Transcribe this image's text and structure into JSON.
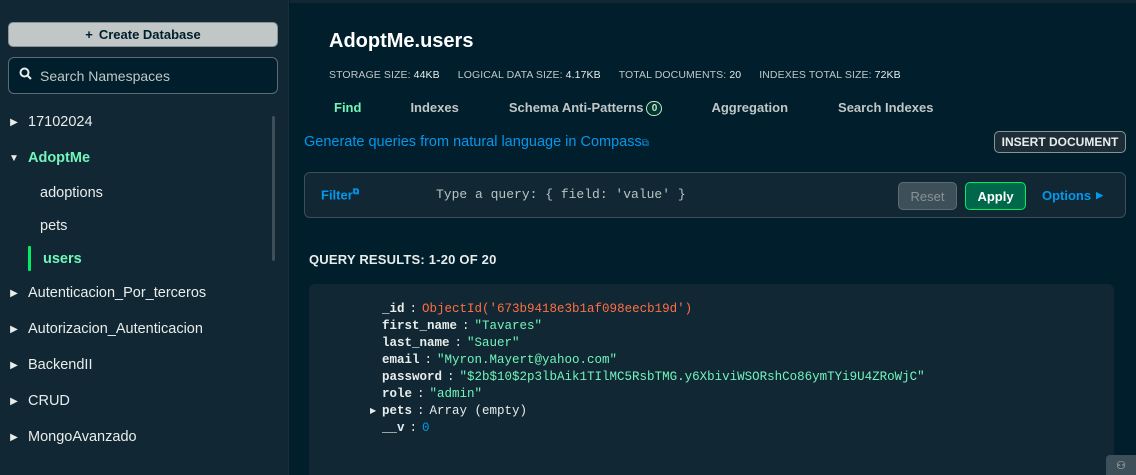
{
  "sidebar": {
    "create_label": "Create Database",
    "search_placeholder": "Search Namespaces",
    "databases": [
      {
        "name": "17102024"
      },
      {
        "name": "AdoptMe",
        "collections": [
          "adoptions",
          "pets",
          "users"
        ],
        "active_collection": "users"
      },
      {
        "name": "Autenticacion_Por_terceros"
      },
      {
        "name": "Autorizacion_Autenticacion"
      },
      {
        "name": "BackendII"
      },
      {
        "name": "CRUD"
      },
      {
        "name": "MongoAvanzado"
      }
    ]
  },
  "header": {
    "title": "AdoptMe.users",
    "stats": [
      {
        "label": "STORAGE SIZE:",
        "value": "44KB"
      },
      {
        "label": "LOGICAL DATA SIZE:",
        "value": "4.17KB"
      },
      {
        "label": "TOTAL DOCUMENTS:",
        "value": "20"
      },
      {
        "label": "INDEXES TOTAL SIZE:",
        "value": "72KB"
      }
    ],
    "tabs": [
      {
        "label": "Find",
        "active": true
      },
      {
        "label": "Indexes"
      },
      {
        "label": "Schema Anti-Patterns",
        "badge": "0"
      },
      {
        "label": "Aggregation"
      },
      {
        "label": "Search Indexes"
      }
    ]
  },
  "toolbar": {
    "nl_link": "Generate queries from natural language in Compass",
    "insert_label": "INSERT DOCUMENT",
    "filter_label": "Filter",
    "query_placeholder": "Type a query: { field: 'value' }",
    "reset_label": "Reset",
    "apply_label": "Apply",
    "options_label": "Options"
  },
  "results": {
    "label": "QUERY RESULTS: 1-20 OF 20",
    "document": {
      "id_key": "_id",
      "id_value": "ObjectId('673b9418e3b1af098eecb19d')",
      "first_name_key": "first_name",
      "first_name_value": "\"Tavares\"",
      "last_name_key": "last_name",
      "last_name_value": "\"Sauer\"",
      "email_key": "email",
      "email_value": "\"Myron.Mayert@yahoo.com\"",
      "password_key": "password",
      "password_value": "\"$2b$10$2p3lbAik1TIlMC5RsbTMG.y6XbiviWSORshCo86ymTYi9U4ZRoWjC\"",
      "role_key": "role",
      "role_value": "\"admin\"",
      "pets_key": "pets",
      "pets_value": "Array (empty)",
      "v_key": "__v",
      "v_value": "0"
    }
  },
  "colors": {
    "accent_green": "#71f6ba",
    "link_blue": "#0498ec",
    "objectid_orange": "#ff6f44",
    "background": "#001e2b"
  }
}
